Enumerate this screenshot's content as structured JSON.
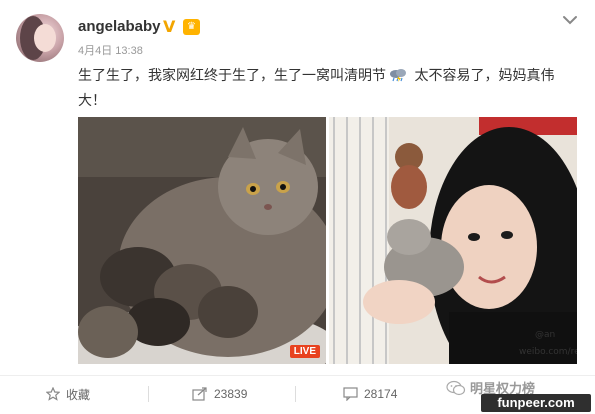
{
  "post": {
    "username": "angelababy",
    "verified_badge": "V",
    "timestamp": "4月4日 13:38",
    "content_part1": "生了生了，我家网红终于生了，生了一窝叫清明节",
    "content_part2": " 太不容易了，妈妈真伟大！",
    "emoji_icon": "cloud-rain-icon"
  },
  "media": {
    "left_badge": "LIVE",
    "right_watermark_handle": "@an",
    "right_watermark_url": "weibo.com/realan"
  },
  "actions": {
    "favorite_label": "收藏",
    "repost_count": "23839",
    "comment_count": "28174"
  },
  "watermark": {
    "brand_text": "明星权力榜",
    "site_text": "funpeer.com"
  },
  "colors": {
    "verified": "#f2a500",
    "live": "#e8421f"
  }
}
